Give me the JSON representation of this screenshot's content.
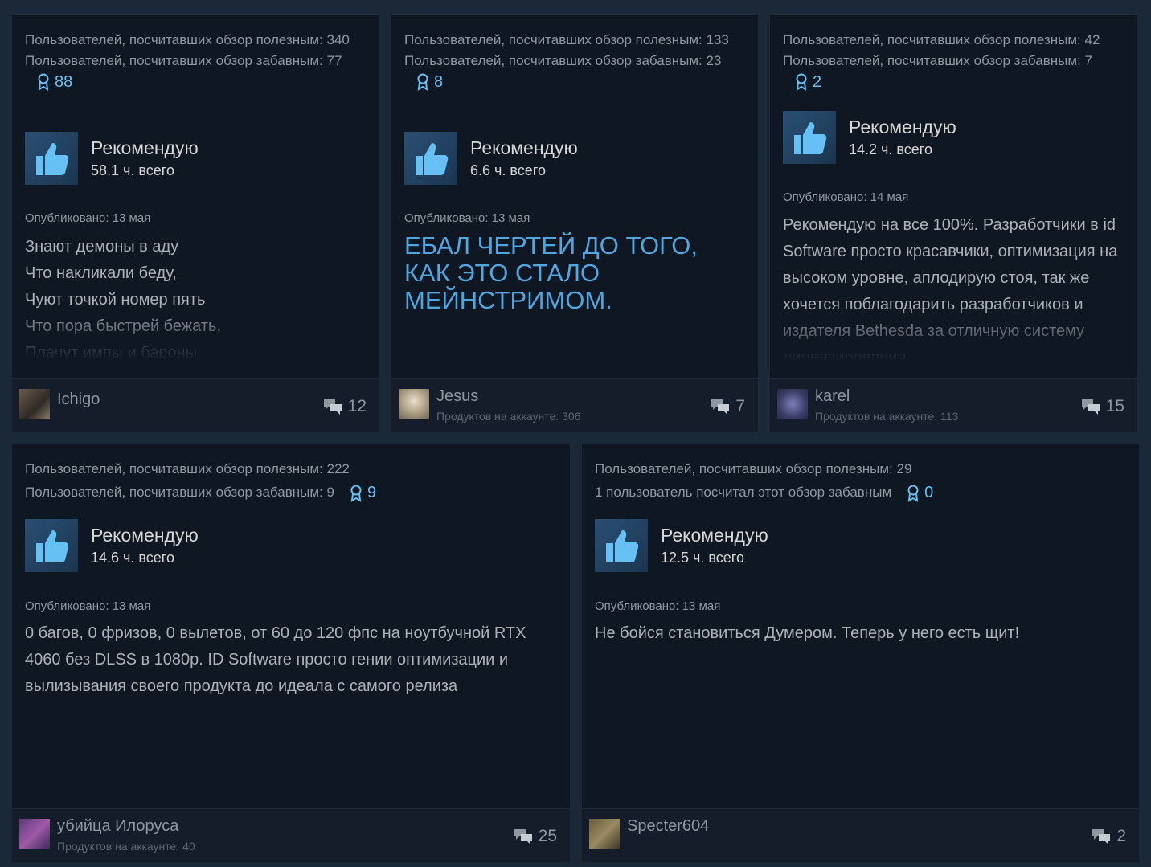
{
  "reviews": [
    {
      "helpful": "Пользователей, посчитавших обзор полезным: 340",
      "funny": "Пользователей, посчитавших обзор забавным: 77",
      "awards": "88",
      "recommend": "Рекомендую",
      "hours": "58.1 ч. всего",
      "posted": "Опубликовано: 13 мая",
      "lines": [
        "Знают демоны в аду",
        "Что накликали беду,",
        "Чуют точкой номер пять",
        "Что пора быстрей бежать,",
        "Плачут импы и бароны"
      ],
      "user": "Ichigo",
      "products": "",
      "comments": "12"
    },
    {
      "helpful": "Пользователей, посчитавших обзор полезным: 133",
      "funny": "Пользователей, посчитавших обзор забавным: 23",
      "awards": "8",
      "recommend": "Рекомендую",
      "hours": "6.6 ч. всего",
      "posted": "Опубликовано: 13 мая",
      "shout": "ЕБАЛ ЧЕРТЕЙ ДО ТОГО, КАК ЭТО СТАЛО МЕЙНСТРИМОМ.",
      "user": "Jesus",
      "products": "Продуктов на аккаунте: 306",
      "comments": "7"
    },
    {
      "helpful": "Пользователей, посчитавших обзор полезным: 42",
      "funny": "Пользователей, посчитавших обзор забавным: 7",
      "awards": "2",
      "recommend": "Рекомендую",
      "hours": "14.2 ч. всего",
      "posted": "Опубликовано: 14 мая",
      "text": "Рекомендую на все 100%. Разработчики в id Software просто красавчики, оптимизация на высоком уровне, аплодирую стоя, так же хочется поблагодарить разработчиков и издателя Bethesda за отличную систему лицензирования",
      "user": "karel",
      "products": "Продуктов на аккаунте: 113",
      "comments": "15"
    },
    {
      "helpful": "Пользователей, посчитавших обзор полезным: 222",
      "funny": "Пользователей, посчитавших обзор забавным: 9",
      "awards": "9",
      "recommend": "Рекомендую",
      "hours": "14.6 ч. всего",
      "posted": "Опубликовано: 13 мая",
      "text": "0 багов, 0 фризов, 0 вылетов, от 60 до 120 фпс на ноутбучной RTX 4060 без DLSS в 1080p. ID Software просто гении оптимизации и вылизывания своего продукта до идеала с самого релиза",
      "user": "убийца Илоруса",
      "products": "Продуктов на аккаунте: 40",
      "comments": "25"
    },
    {
      "helpful": "Пользователей, посчитавших обзор полезным: 29",
      "funny": "1 пользователь посчитал этот обзор забавным",
      "awards": "0",
      "recommend": "Рекомендую",
      "hours": "12.5 ч. всего",
      "posted": "Опубликовано: 13 мая",
      "text": "Не бойся становиться Думером. Теперь у него есть щит!",
      "user": "Specter604",
      "products": "",
      "comments": "2"
    }
  ],
  "colors": {
    "background": "#1b2838",
    "card": "#0f1722",
    "accent": "#66c0f4"
  },
  "icons": {
    "thumb": "thumbs-up-icon",
    "award": "award-icon",
    "comments": "comments-icon"
  }
}
